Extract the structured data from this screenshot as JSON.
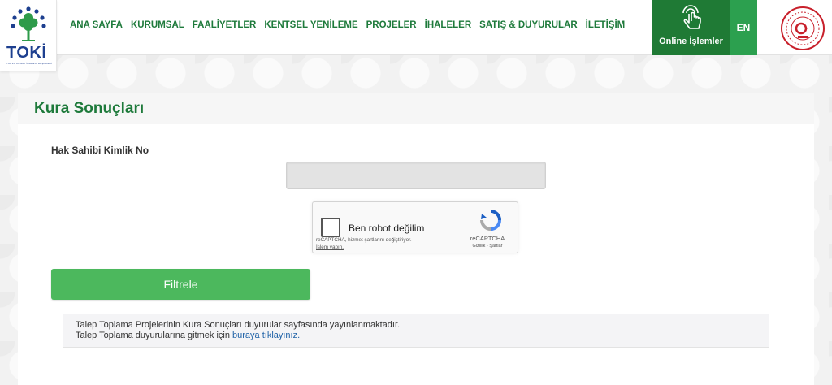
{
  "brand": {
    "logo_text": "TOKİ",
    "logo_subtext": "TOPLU KONUT İDARESİ BAŞKANLIĞI"
  },
  "nav": {
    "items": [
      {
        "label": "ANA SAYFA"
      },
      {
        "label": "KURUMSAL"
      },
      {
        "label": "FAALİYETLER"
      },
      {
        "label": "KENTSEL YENİLEME"
      },
      {
        "label": "PROJELER"
      },
      {
        "label": "İHALELER"
      },
      {
        "label": "SATIŞ & DUYURULAR"
      },
      {
        "label": "İLETİŞİM"
      }
    ],
    "online_label": "Online İşlemler",
    "online_icon": "touch-hand-icon",
    "lang_label": "EN"
  },
  "colors": {
    "primary_green": "#1e7a3b",
    "button_green": "#4cb85d",
    "online_bg": "#1f7a35",
    "en_bg": "#2ca04f",
    "link_blue": "#1f62a7"
  },
  "page": {
    "title": "Kura Sonuçları",
    "field_label": "Hak Sahibi Kimlik No",
    "field_value": "",
    "field_placeholder": "",
    "captcha": {
      "label": "Ben robot değilim",
      "note_line1": "reCAPTCHA, hizmet şartlarını değiştiriyor.",
      "note_link": "İşlem yapın.",
      "brand": "reCAPTCHA",
      "links": "Gizlilik - Şartlar"
    },
    "filter_button": "Filtrele",
    "notice": {
      "line1": "Talep Toplama Projelerinin Kura Sonuçları duyurular sayfasında yayınlanmaktadır.",
      "line2_prefix": "Talep Toplama duyurularına gitmek için ",
      "line2_link": "buraya tıklayınız."
    }
  }
}
